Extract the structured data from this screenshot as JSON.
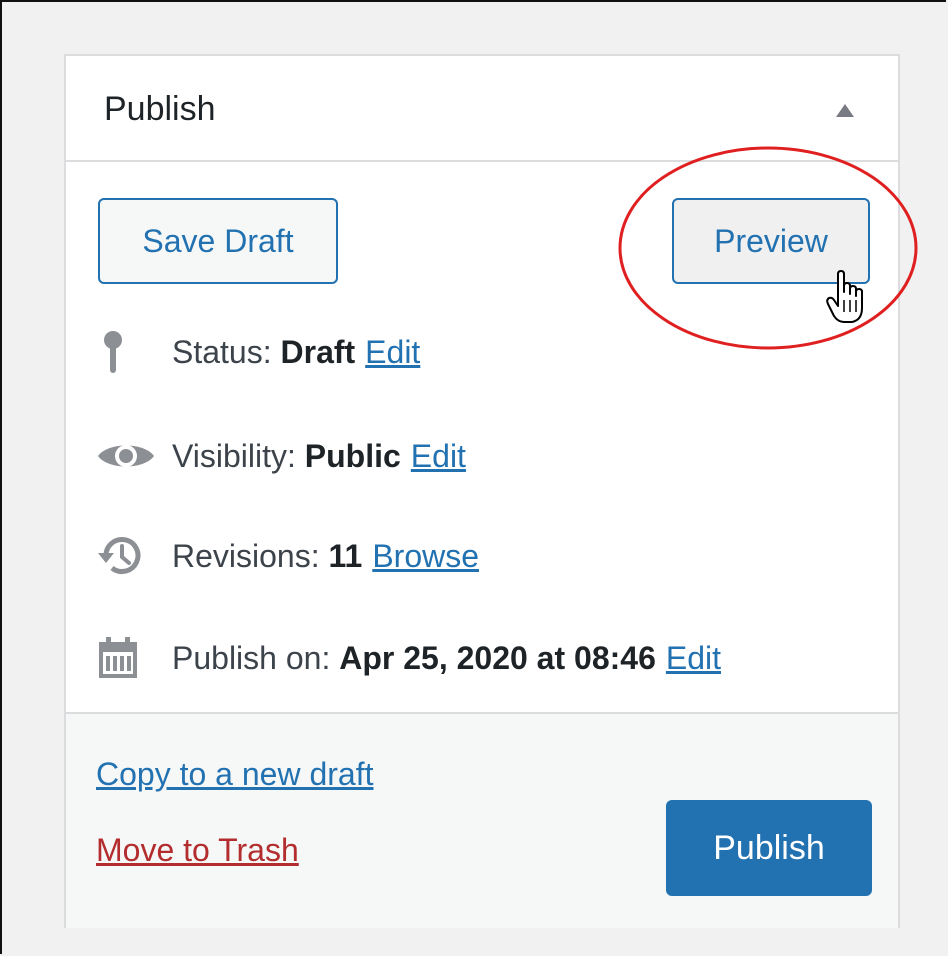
{
  "panel": {
    "title": "Publish",
    "toggle_icon": "triangle-up-icon"
  },
  "actions": {
    "save_draft_label": "Save Draft",
    "preview_label": "Preview"
  },
  "misc": {
    "status": {
      "icon": "pin-icon",
      "label": "Status: ",
      "value": "Draft",
      "link": "Edit"
    },
    "visibility": {
      "icon": "eye-icon",
      "label": "Visibility: ",
      "value": "Public",
      "link": "Edit"
    },
    "revisions": {
      "icon": "history-icon",
      "label": "Revisions: ",
      "value": "11",
      "link": "Browse"
    },
    "publish_on": {
      "icon": "calendar-icon",
      "label": "Publish on: ",
      "value": "Apr 25, 2020 at 08:46",
      "link": "Edit"
    }
  },
  "footer": {
    "copy_link": "Copy to a new draft",
    "trash_link": "Move to Trash",
    "publish_label": "Publish"
  },
  "colors": {
    "accent": "#2271b1",
    "danger": "#b32d2e",
    "annotation": "#e02020"
  }
}
